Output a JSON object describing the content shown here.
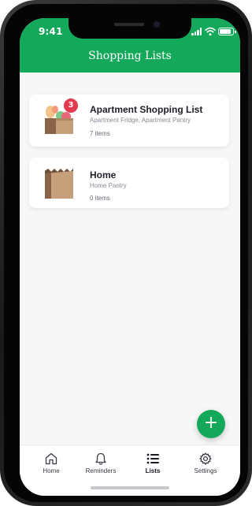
{
  "status_bar": {
    "time": "9:41"
  },
  "header": {
    "title": "Shopping Lists"
  },
  "lists": [
    {
      "name": "Apartment Shopping List",
      "locations": "Apartment Fridge, Apartment Pantry",
      "item_count": "7 items",
      "badge": "3",
      "icon": "grocery-bag-full-icon"
    },
    {
      "name": "Home",
      "locations": "Home Pantry",
      "item_count": "0 items",
      "icon": "grocery-bag-empty-icon"
    }
  ],
  "fab": {
    "label": "+"
  },
  "tabs": [
    {
      "label": "Home",
      "icon": "home-icon",
      "active": false
    },
    {
      "label": "Reminders",
      "icon": "bell-icon",
      "active": false
    },
    {
      "label": "Lists",
      "icon": "list-icon",
      "active": true
    },
    {
      "label": "Settings",
      "icon": "gear-icon",
      "active": false
    }
  ],
  "colors": {
    "primary": "#14a85a",
    "badge": "#e23a50",
    "background": "#f7f7f7"
  }
}
